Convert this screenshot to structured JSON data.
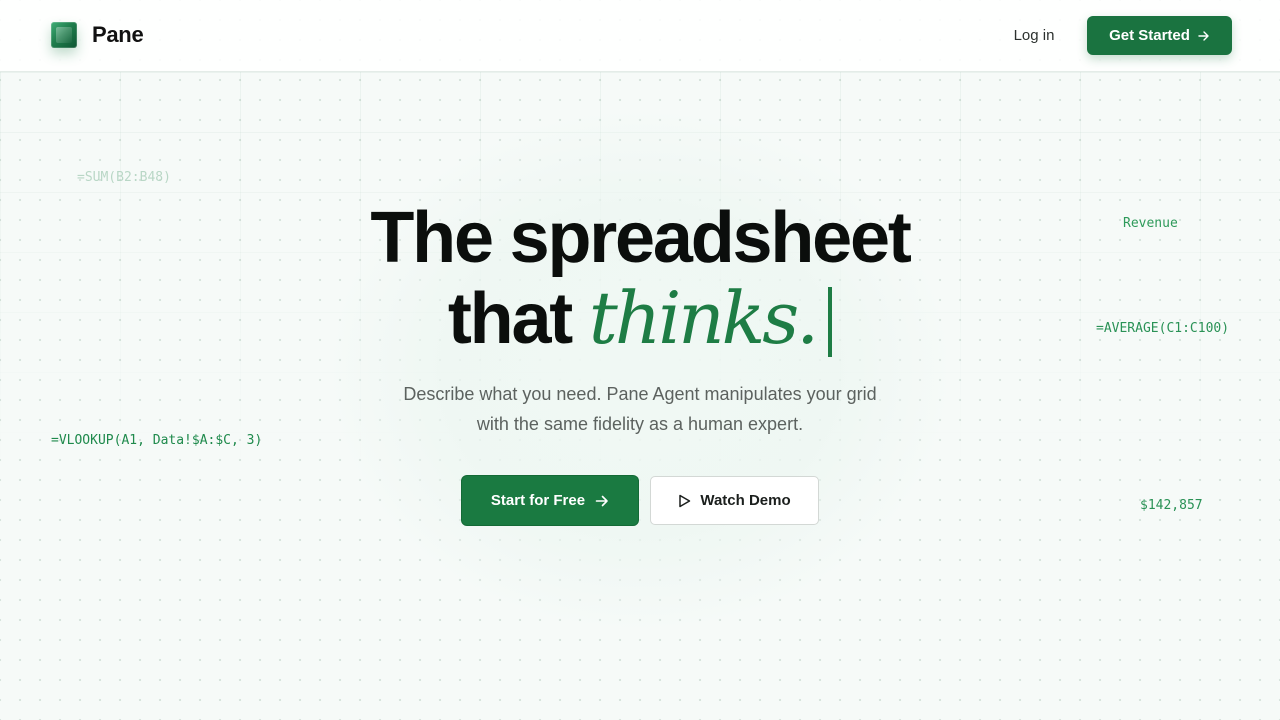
{
  "brand": {
    "name": "Pane"
  },
  "nav": {
    "login_label": "Log in",
    "cta_label": "Get Started"
  },
  "hero": {
    "headline_line1": "The spreadsheet",
    "headline_line2_prefix": "that",
    "headline_line2_accent": "thinks.",
    "subtitle_line1": "Describe what you need. Pane Agent manipulates your grid",
    "subtitle_line2": "with the same fidelity as a human expert.",
    "primary_button": "Start for Free",
    "secondary_button": "Watch Demo"
  },
  "floating_labels": [
    "=SUM(B2:B48)",
    "Revenue",
    "=AVERAGE(C1:C100)",
    "=VLOOKUP(A1, Data!$A:$C, 3)",
    "$142,857"
  ],
  "colors": {
    "brand_green": "#1a7a41",
    "accent_green": "#1e7d45",
    "background": "#f6faf8"
  },
  "icons": {
    "logo": "pane-logo-icon",
    "cta_arrow": "arrow-right-icon",
    "play": "play-icon"
  }
}
